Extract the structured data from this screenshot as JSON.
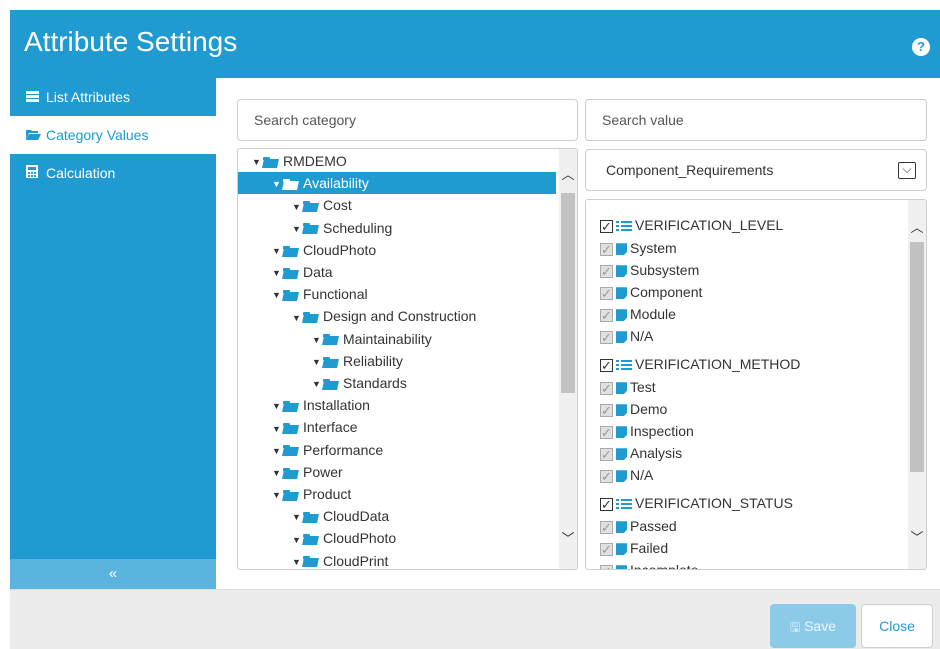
{
  "header": {
    "title": "Attribute Settings",
    "help_label": "?"
  },
  "sidebar": {
    "items": [
      {
        "label": "List Attributes",
        "icon": "list-icon"
      },
      {
        "label": "Category Values",
        "icon": "folder-open-icon"
      },
      {
        "label": "Calculation",
        "icon": "calculator-icon"
      }
    ],
    "collapse_label": "«",
    "active_index": 1
  },
  "category_search": {
    "placeholder": "Search category"
  },
  "value_search": {
    "placeholder": "Search value"
  },
  "category_tree": [
    {
      "label": "RMDEMO",
      "level": 0
    },
    {
      "label": "Availability",
      "level": 1,
      "selected": true
    },
    {
      "label": "Cost",
      "level": 2
    },
    {
      "label": "Scheduling",
      "level": 2
    },
    {
      "label": "CloudPhoto",
      "level": 1
    },
    {
      "label": "Data",
      "level": 1
    },
    {
      "label": "Functional",
      "level": 1
    },
    {
      "label": "Design and Construction",
      "level": 2
    },
    {
      "label": "Maintainability",
      "level": 3
    },
    {
      "label": "Reliability",
      "level": 3
    },
    {
      "label": "Standards",
      "level": 3
    },
    {
      "label": "Installation",
      "level": 1
    },
    {
      "label": "Interface",
      "level": 1
    },
    {
      "label": "Performance",
      "level": 1
    },
    {
      "label": "Power",
      "level": 1
    },
    {
      "label": "Product",
      "level": 1
    },
    {
      "label": "CloudData",
      "level": 2
    },
    {
      "label": "CloudPhoto",
      "level": 2
    },
    {
      "label": "CloudPrint",
      "level": 2
    }
  ],
  "attribute_select": {
    "value": "Component_Requirements"
  },
  "value_groups": [
    {
      "name": "VERIFICATION_LEVEL",
      "values": [
        "System",
        "Subsystem",
        "Component",
        "Module",
        "N/A"
      ]
    },
    {
      "name": "VERIFICATION_METHOD",
      "values": [
        "Test",
        "Demo",
        "Inspection",
        "Analysis",
        "N/A"
      ]
    },
    {
      "name": "VERIFICATION_STATUS",
      "values": [
        "Passed",
        "Failed",
        "Incomplete"
      ]
    }
  ],
  "footer": {
    "save_label": "Save",
    "close_label": "Close"
  },
  "colors": {
    "accent": "#1f9bd1",
    "save_disabled": "#8ccbe8"
  }
}
